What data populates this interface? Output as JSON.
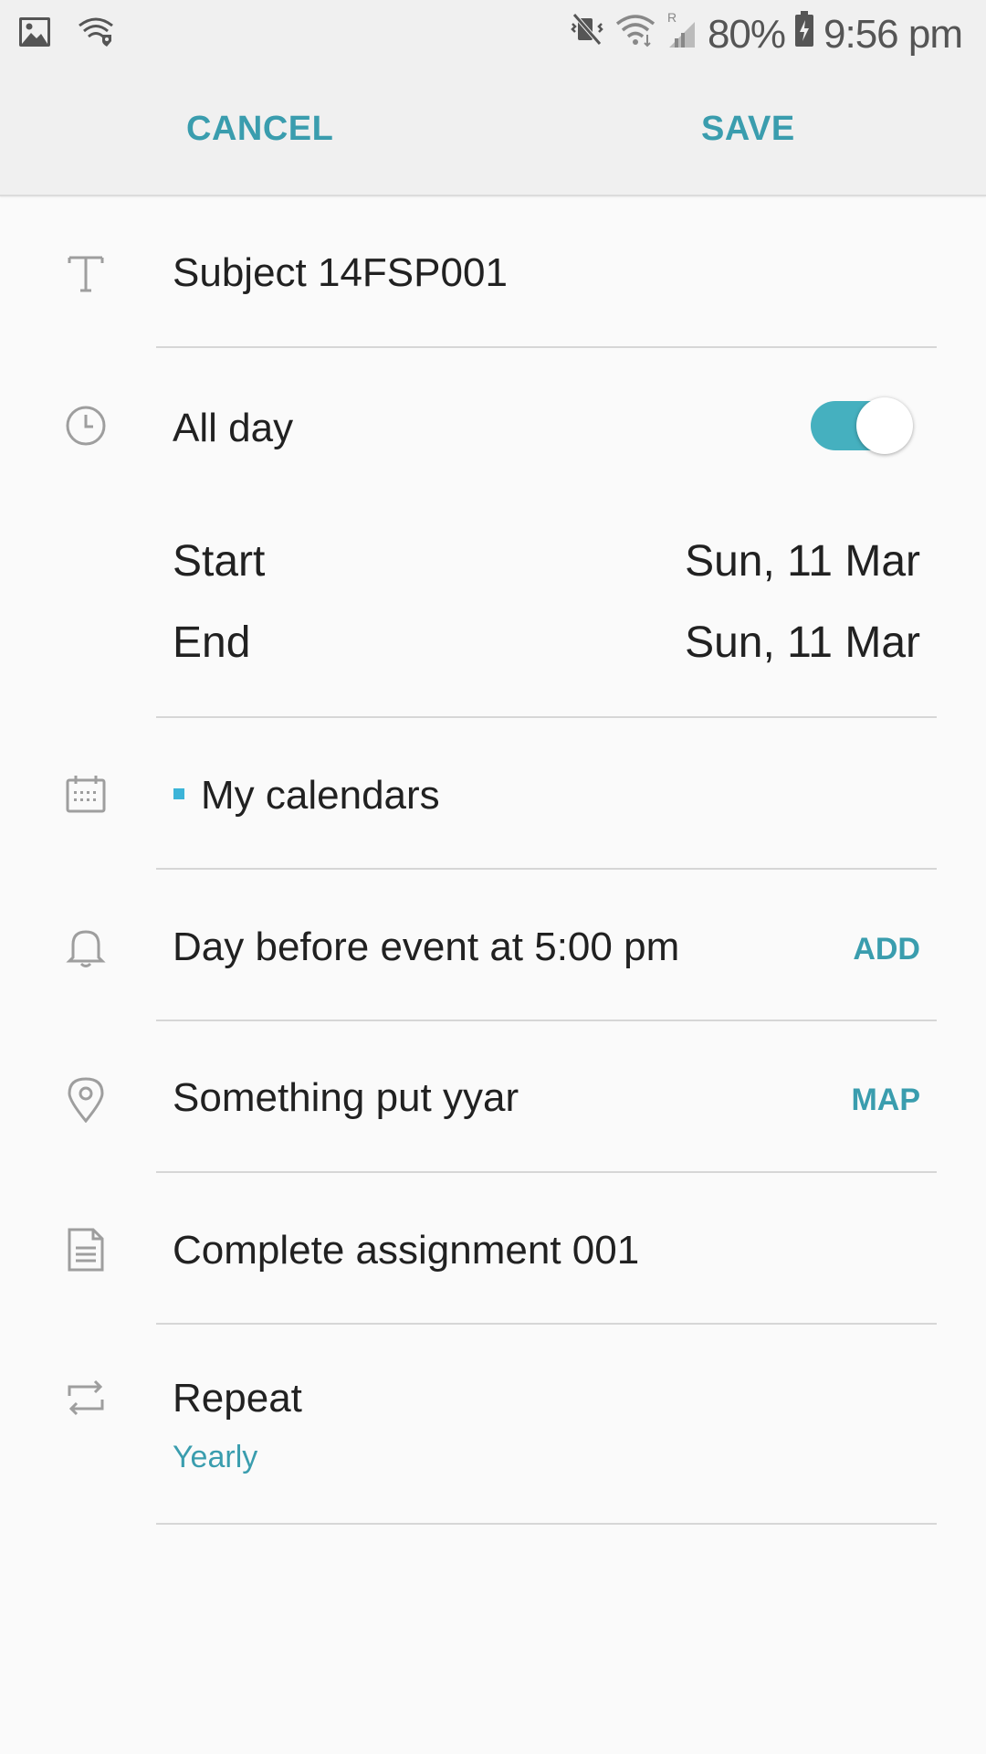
{
  "status_bar": {
    "battery": "80%",
    "time": "9:56 pm",
    "icons": [
      "image-icon",
      "wifi-shield-icon",
      "mute-vibrate-icon",
      "wifi-icon",
      "roaming-signal-icon",
      "battery-charging-icon"
    ]
  },
  "action_bar": {
    "cancel_label": "CANCEL",
    "save_label": "SAVE"
  },
  "event": {
    "title": "Subject 14FSP001",
    "all_day_label": "All day",
    "all_day_on": true,
    "start_label": "Start",
    "start_value": "Sun, 11 Mar",
    "end_label": "End",
    "end_value": "Sun, 11 Mar",
    "calendar": "My calendars",
    "calendar_color": "#3cb4d8",
    "reminder": "Day before event at 5:00 pm",
    "reminder_action": "ADD",
    "location": "Something put yyar",
    "location_action": "MAP",
    "notes": "Complete assignment 001",
    "repeat_label": "Repeat",
    "repeat_value": "Yearly"
  },
  "colors": {
    "accent": "#3a9dae",
    "toggle_on": "#45b0bf"
  }
}
